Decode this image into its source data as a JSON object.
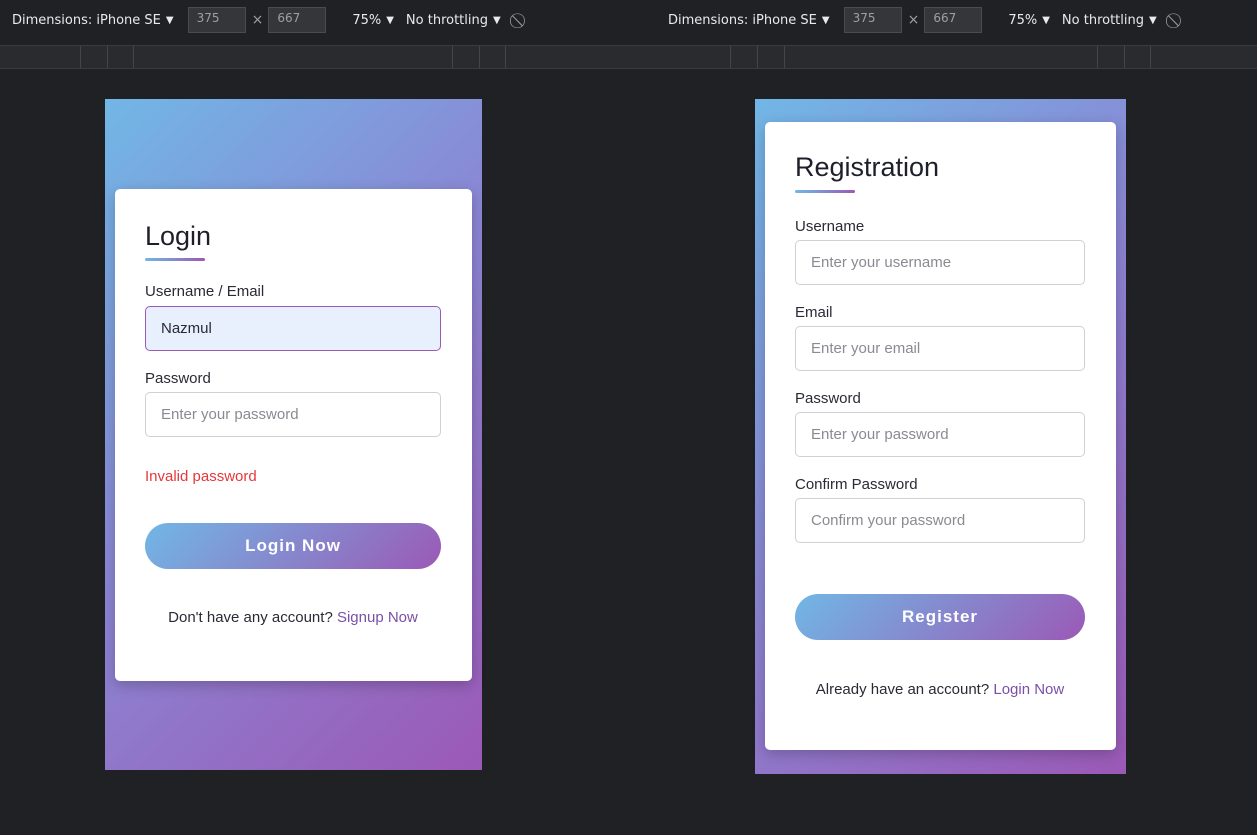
{
  "devtools": [
    {
      "device_label": "Dimensions: iPhone SE",
      "width": "375",
      "height": "667",
      "zoom": "75%",
      "throttling": "No throttling"
    },
    {
      "device_label": "Dimensions: iPhone SE",
      "width": "375",
      "height": "667",
      "zoom": "75%",
      "throttling": "No throttling"
    }
  ],
  "login": {
    "title": "Login",
    "username_label": "Username / Email",
    "username_value": "Nazmul",
    "password_label": "Password",
    "password_placeholder": "Enter your password",
    "error": "Invalid password",
    "button": "Login Now",
    "footer_text": "Don't have any account?",
    "footer_link": "Signup Now"
  },
  "register": {
    "title": "Registration",
    "username_label": "Username",
    "username_placeholder": "Enter your username",
    "email_label": "Email",
    "email_placeholder": "Enter your email",
    "password_label": "Password",
    "password_placeholder": "Enter your password",
    "confirm_label": "Confirm Password",
    "confirm_placeholder": "Confirm your password",
    "button": "Register",
    "footer_text": "Already have an account?",
    "footer_link": "Login Now"
  },
  "colors": {
    "gradient_start": "#71b7e6",
    "gradient_end": "#9b59b6",
    "error": "#e5383b",
    "link": "#7b4fa6"
  }
}
